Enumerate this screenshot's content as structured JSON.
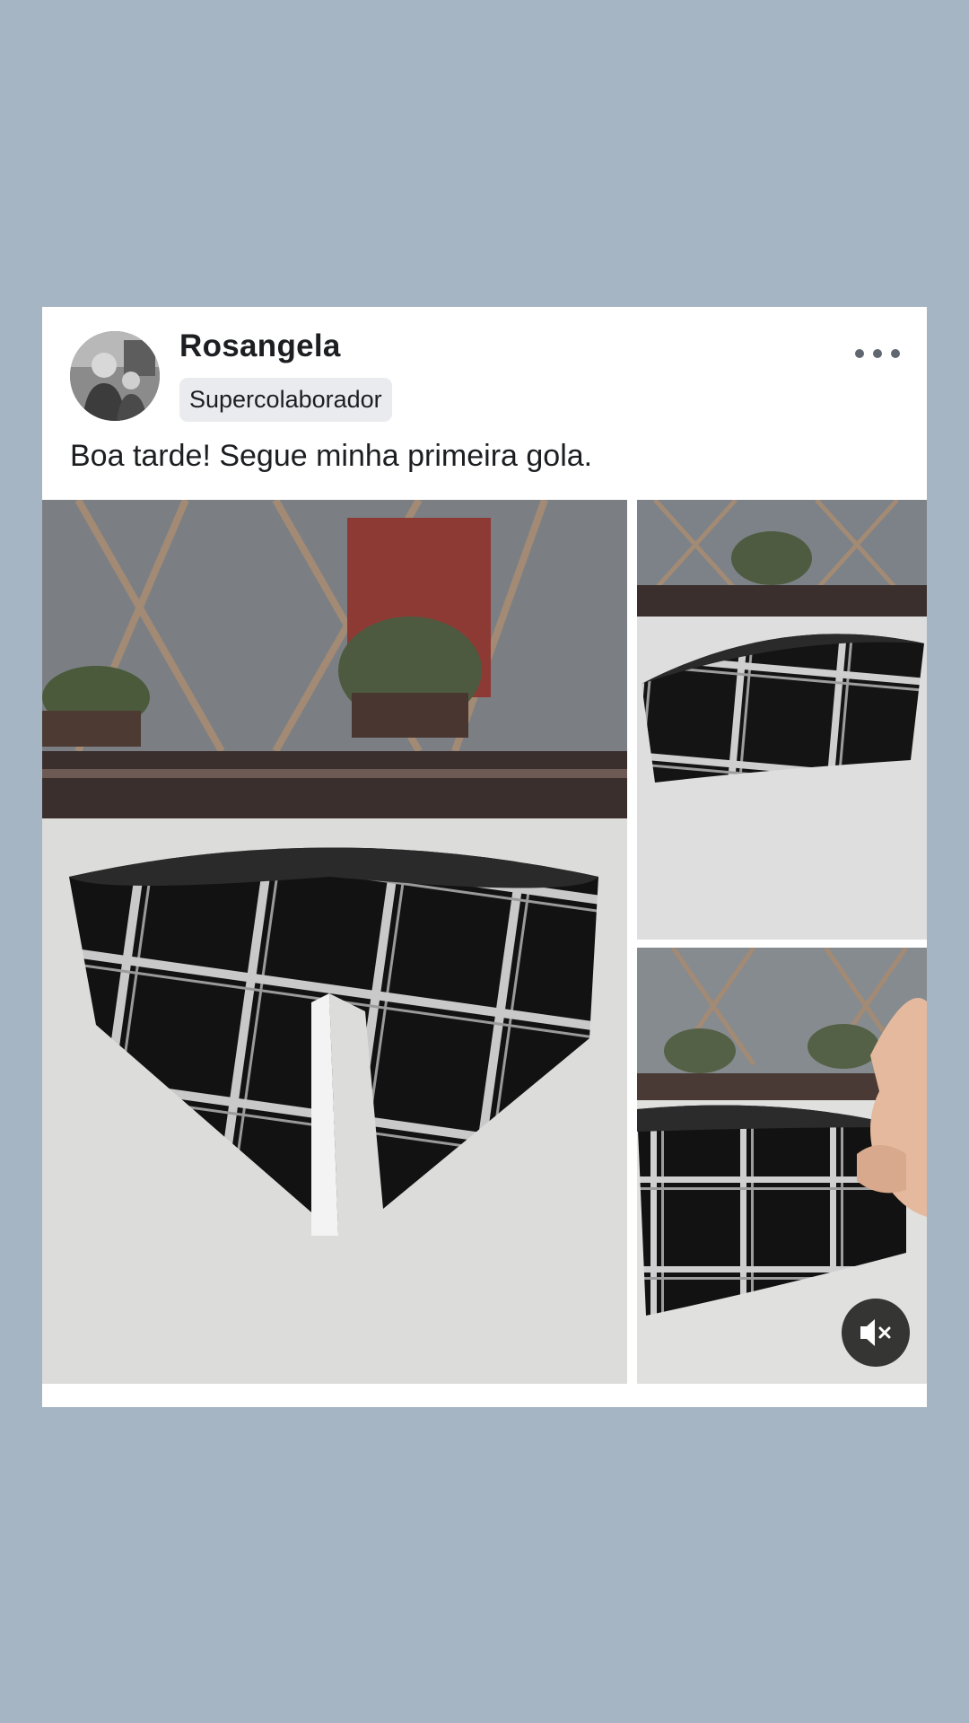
{
  "post": {
    "author": "Rosangela",
    "badge": "Supercolaborador",
    "text": "Boa tarde! Segue minha primeira gola.",
    "more_icon": "more-horizontal-icon",
    "avatar_icon": "profile-photo",
    "photos": [
      {
        "name": "main-collar-photo",
        "count_index": 1
      },
      {
        "name": "side-collar-photo",
        "count_index": 2
      },
      {
        "name": "video-collar-photo",
        "count_index": 3
      }
    ],
    "mute_icon": "muted-speaker-icon"
  },
  "colors": {
    "background": "#a5b5c4",
    "card": "#ffffff",
    "text": "#1c1e21",
    "badge_bg": "#e9ebee",
    "icon_grey": "#606770"
  }
}
